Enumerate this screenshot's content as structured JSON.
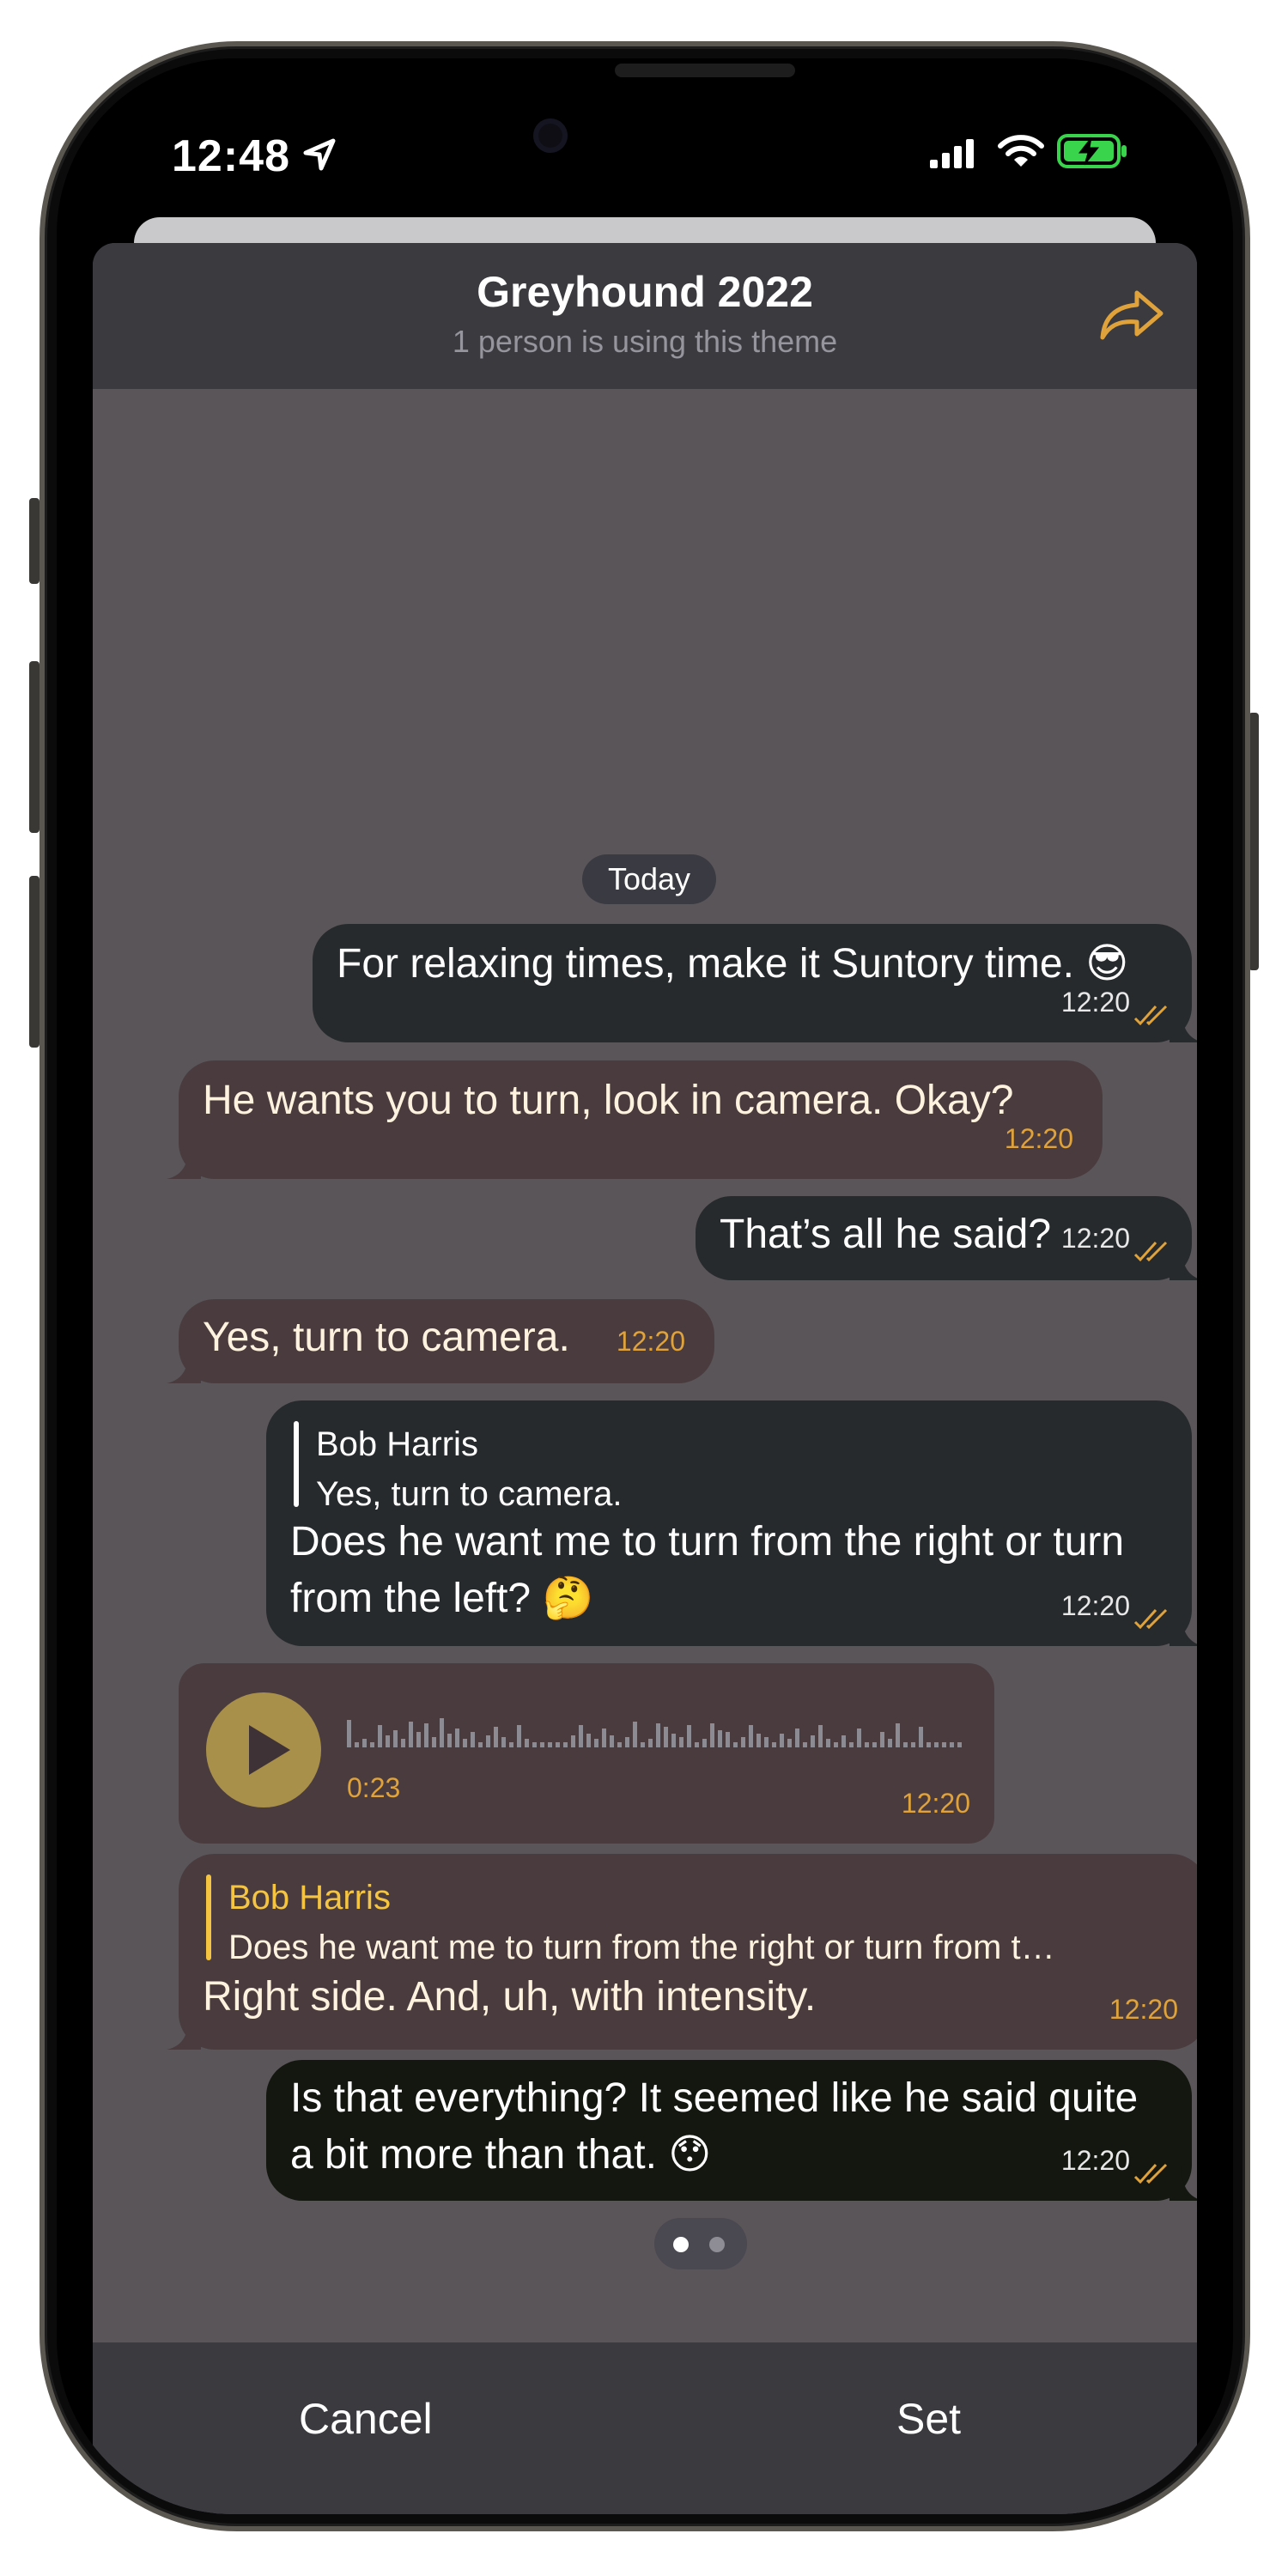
{
  "status": {
    "time": "12:48"
  },
  "theme": {
    "title": "Greyhound 2022",
    "subtitle": "1 person is using this theme",
    "date_chip": "Today"
  },
  "messages": [
    {
      "side": "out",
      "text": "For relaxing times, make it Suntory time. 😎",
      "time": "12:20"
    },
    {
      "side": "in",
      "text": "He wants you to turn, look in camera. Okay?",
      "time": "12:20"
    },
    {
      "side": "out",
      "text": "That’s all he said?",
      "time": "12:20"
    },
    {
      "side": "in",
      "text": "Yes, turn to camera.",
      "time": "12:20"
    },
    {
      "side": "out",
      "reply_name": "Bob Harris",
      "reply_text": "Yes, turn to camera.",
      "text_line1": "Does he want me to turn from the right or turn",
      "text_line2": "from the left? 🤔",
      "time": "12:20"
    },
    {
      "side": "in",
      "type": "voice",
      "duration": "0:23",
      "time": "12:20"
    },
    {
      "side": "in",
      "reply_name": "Bob Harris",
      "reply_text": "Does he want me to turn from the right or turn from t…",
      "text": "Right side. And, uh, with intensity.",
      "time": "12:20"
    },
    {
      "side": "out",
      "text_line1": "Is that everything? It seemed like he said quite",
      "text_line2": "a bit more than that. 😯",
      "time": "12:20"
    }
  ],
  "footer": {
    "cancel": "Cancel",
    "set": "Set"
  },
  "colors": {
    "accent": "#e0a23a",
    "reply_accent": "#f5c542",
    "incoming": "#4a3c3e",
    "outgoing": "#262a2c"
  }
}
